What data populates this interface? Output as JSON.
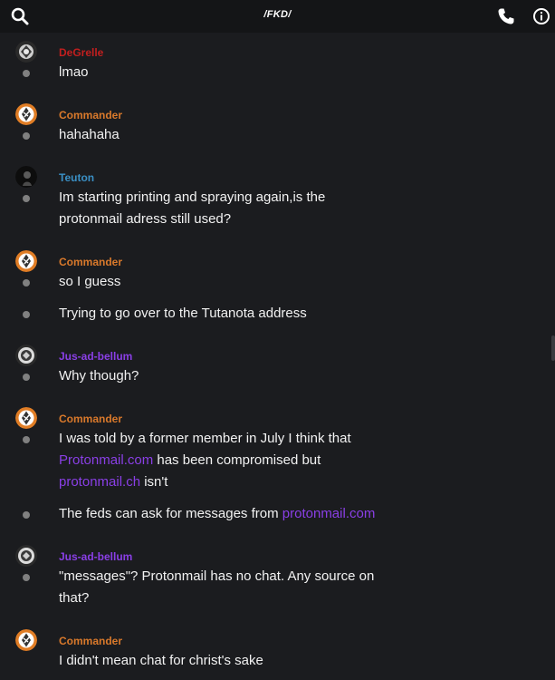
{
  "header": {
    "title": "/FKD/",
    "icons": {
      "search": "search-icon",
      "call": "phone-icon",
      "info": "info-icon"
    }
  },
  "colors": {
    "background": "#1b1c1f",
    "topbar": "#141517",
    "link": "#8a3fe6",
    "degrelle": "#c21f1f",
    "commander": "#d9792b",
    "teuton": "#3a8fc4",
    "jus": "#8a3fe6",
    "dot": "#808080"
  },
  "messages": {
    "g1": {
      "author": "DeGrelle",
      "m1": "lmao"
    },
    "g2": {
      "author": "Commander",
      "m1": "hahahaha"
    },
    "g3": {
      "author": "Teuton",
      "m1a": "Im starting printing and spraying again,is the",
      "m1b": "protonmail adress still used?"
    },
    "g4": {
      "author": "Commander",
      "m1": "so I guess",
      "m2": "Trying to go over to the Tutanota address"
    },
    "g5": {
      "author": "Jus-ad-bellum",
      "m1": "Why though?"
    },
    "g6": {
      "author": "Commander",
      "m1a": "I was told by a former member in July I think that",
      "m1b_link": "Protonmail.com",
      "m1b_text": " has been compromised but",
      "m1c_link": "protonmail.ch",
      "m1c_text": " isn't",
      "m2_text": "The feds can ask for messages from ",
      "m2_link": "protonmail.com"
    },
    "g7": {
      "author": "Jus-ad-bellum",
      "m1a": "\"messages\"? Protonmail has no chat. Any source on",
      "m1b": "that?"
    },
    "g8": {
      "author": "Commander",
      "m1": "I didn't mean chat for christ's sake"
    }
  }
}
